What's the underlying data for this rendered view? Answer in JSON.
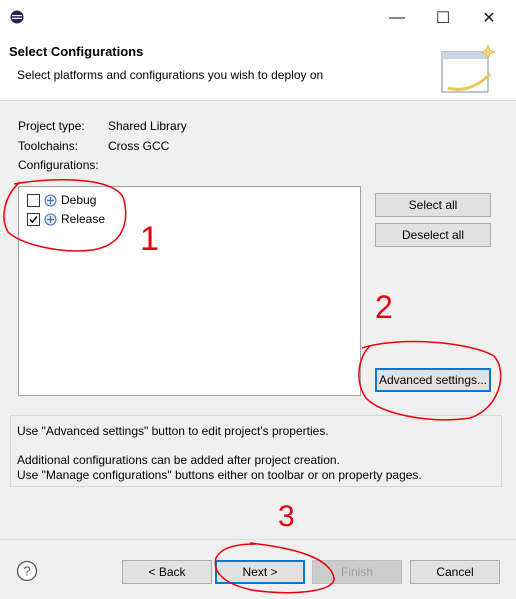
{
  "window": {
    "minimize_glyph": "—",
    "maximize_glyph": "☐",
    "close_glyph": "✕"
  },
  "header": {
    "title": "Select Configurations",
    "subtitle": "Select platforms and configurations you wish to deploy on"
  },
  "project": {
    "type_label": "Project type:",
    "type_value": "Shared Library",
    "toolchains_label": "Toolchains:",
    "toolchains_value": "Cross GCC",
    "configurations_label": "Configurations:"
  },
  "configurations": [
    {
      "label": "Debug",
      "checked": false
    },
    {
      "label": "Release",
      "checked": true
    }
  ],
  "buttons": {
    "select_all": "Select all",
    "deselect_all": "Deselect all",
    "advanced_settings": "Advanced settings...",
    "back": "< Back",
    "next": "Next >",
    "finish": "Finish",
    "cancel": "Cancel"
  },
  "info": {
    "line1": "Use \"Advanced settings\" button to edit project's properties.",
    "line2": "Additional configurations can be added after project creation.",
    "line3": "Use \"Manage configurations\" buttons either on toolbar or on property pages."
  },
  "annotations": {
    "mark1": "1",
    "mark2": "2",
    "mark3": "3",
    "color": "#e8000b"
  },
  "colors": {
    "focus_border": "#0078d7",
    "dialog_bg": "#f0f0f0"
  }
}
